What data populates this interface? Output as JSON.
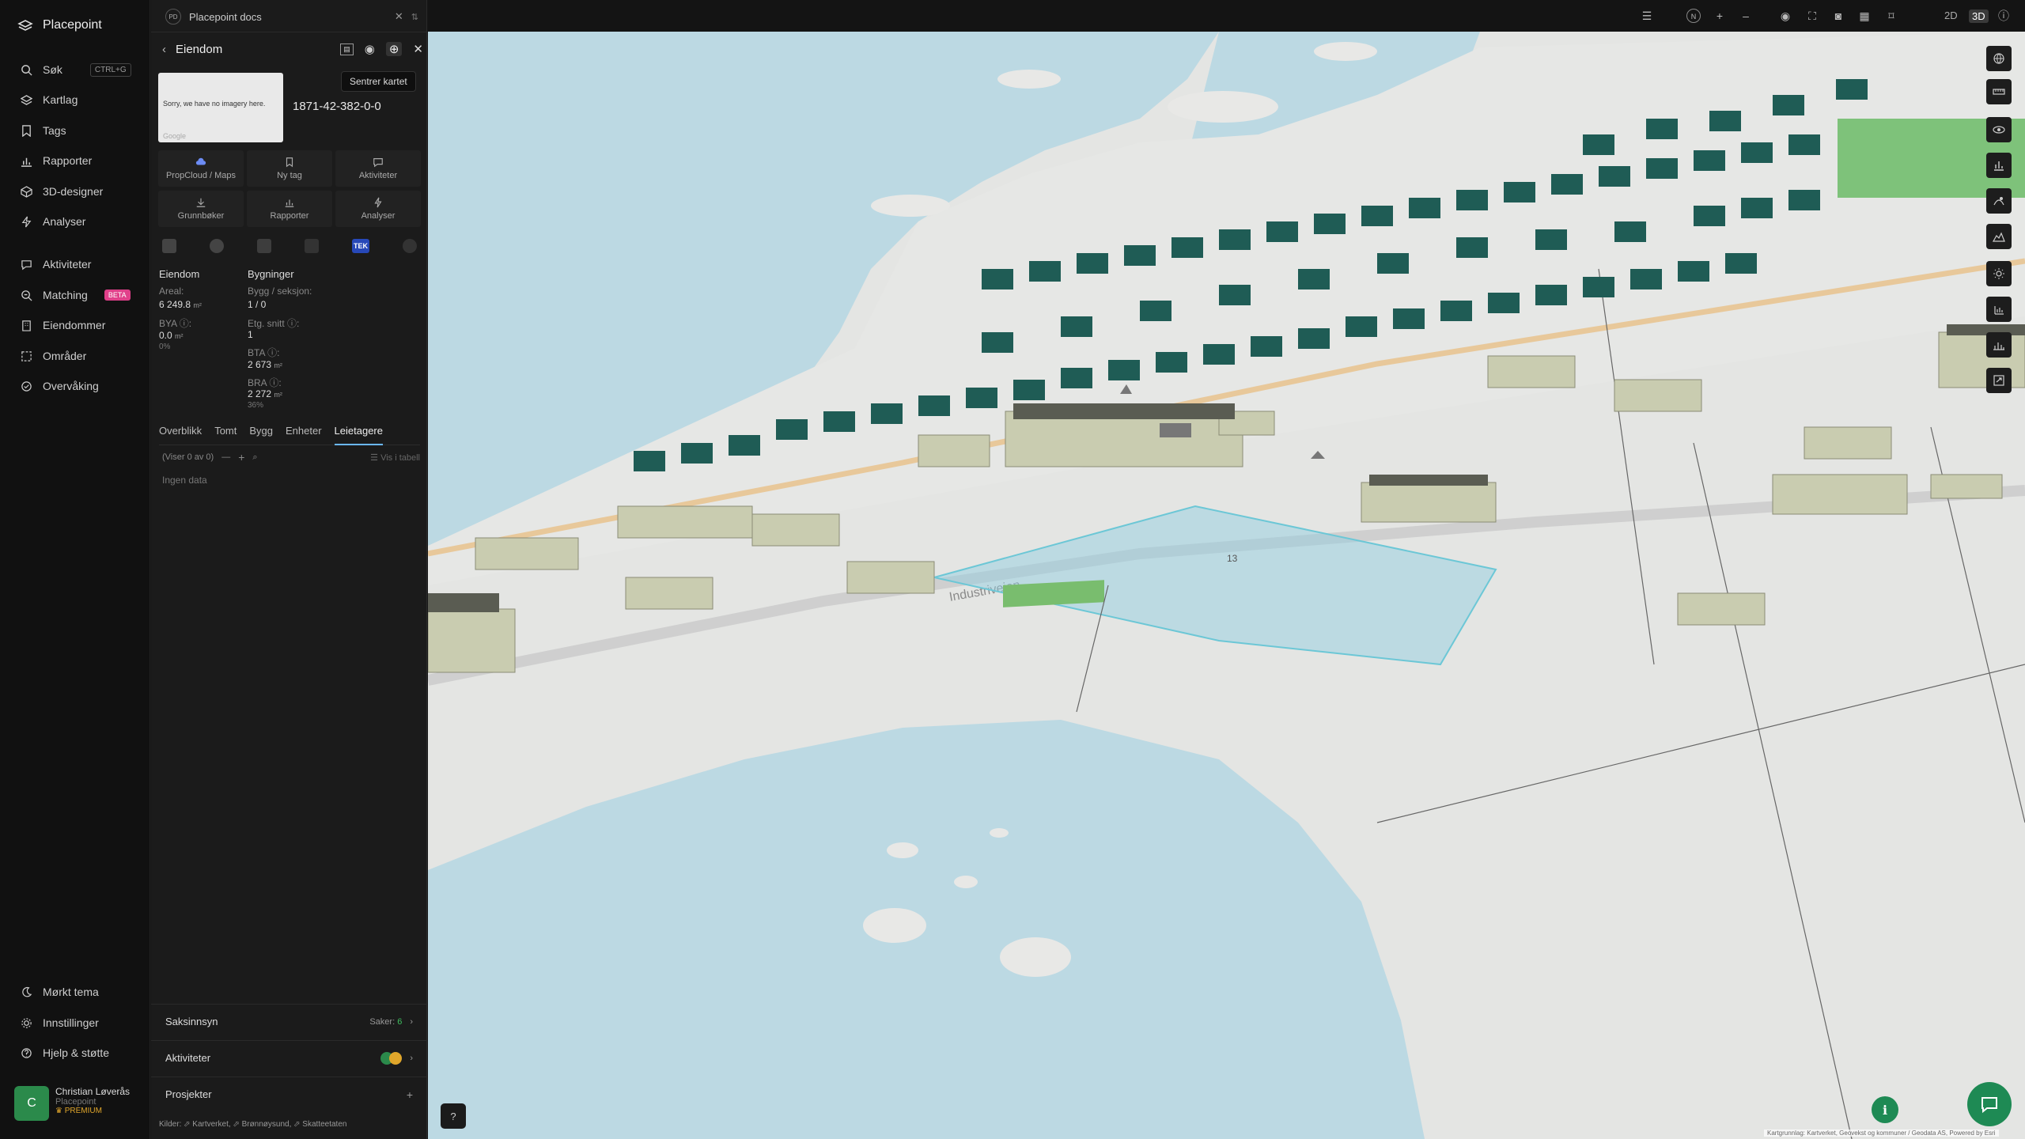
{
  "nav": {
    "brand": "Placepoint",
    "items": [
      {
        "label": "Søk",
        "shortcut": "CTRL+G"
      },
      {
        "label": "Kartlag"
      },
      {
        "label": "Tags"
      },
      {
        "label": "Rapporter"
      },
      {
        "label": "3D-designer"
      },
      {
        "label": "Analyser"
      },
      {
        "label": "Aktiviteter"
      },
      {
        "label": "Matching",
        "badge": "BETA"
      },
      {
        "label": "Eiendommer"
      },
      {
        "label": "Områder"
      },
      {
        "label": "Overvåking"
      }
    ],
    "bottom": [
      {
        "label": "Mørkt tema"
      },
      {
        "label": "Innstillinger"
      },
      {
        "label": "Hjelp & støtte"
      }
    ],
    "user": {
      "initial": "C",
      "name": "Christian Løverås",
      "org": "Placepoint",
      "plan": "PREMIUM"
    }
  },
  "panel": {
    "docs_tab": "Placepoint docs",
    "docs_initials": "PD",
    "title": "Eiendom",
    "tooltip": "Sentrer kartet",
    "thumb_text": "Sorry, we have no imagery here.",
    "thumb_brand": "Google",
    "property_id": "1871-42-382-0-0",
    "actions": [
      {
        "label": "PropCloud / Maps"
      },
      {
        "label": "Ny tag"
      },
      {
        "label": "Aktiviteter"
      },
      {
        "label": "Grunnbøker"
      },
      {
        "label": "Rapporter"
      },
      {
        "label": "Analyser"
      }
    ],
    "tek_label": "TEK",
    "eiendom": {
      "heading": "Eiendom",
      "areal_label": "Areal:",
      "areal_value": "6 249.8",
      "bya_label": "BYA ⓘ:",
      "bya_value": "0.0",
      "bya_pct": "0%",
      "unit": "m²"
    },
    "bygninger": {
      "heading": "Bygninger",
      "bygg_label": "Bygg / seksjon:",
      "bygg_value": "1 / 0",
      "etg_label": "Etg. snitt ⓘ:",
      "etg_value": "1",
      "bta_label": "BTA ⓘ:",
      "bta_value": "2 673",
      "bra_label": "BRA ⓘ:",
      "bra_value": "2 272",
      "bra_pct": "36%",
      "unit": "m²"
    },
    "tabs": [
      "Overblikk",
      "Tomt",
      "Bygg",
      "Enheter",
      "Leietagere"
    ],
    "active_tab": "Leietagere",
    "list_count": "(Viser 0 av 0)",
    "view_table": "Vis i tabell",
    "no_data": "Ingen data",
    "saksinnsyn": {
      "label": "Saksinnsyn",
      "count_label": "Saker:",
      "count": "6"
    },
    "aktiviteter": {
      "label": "Aktiviteter"
    },
    "prosjekter": {
      "label": "Prosjekter"
    },
    "sources": "Kilder: ⬀ Kartverket, ⬀ Brønnøysund, ⬀ Skatteetaten"
  },
  "topbar": {
    "view_2d": "2D",
    "view_3d": "3D",
    "active_view": "3D"
  },
  "map": {
    "road_label": "Industriveien",
    "plot_label": "13",
    "attribution": "Kartgrunnlag: Kartverket, Geovekst og kommuner / Geodata AS, Powered by Esri"
  },
  "colors": {
    "accent": "#6ab7ff",
    "green": "#1e8a54",
    "water": "#bcd9e3",
    "land": "#e6e7e5",
    "building_dark": "#1f5c55",
    "building_light": "#c9ccb0"
  }
}
